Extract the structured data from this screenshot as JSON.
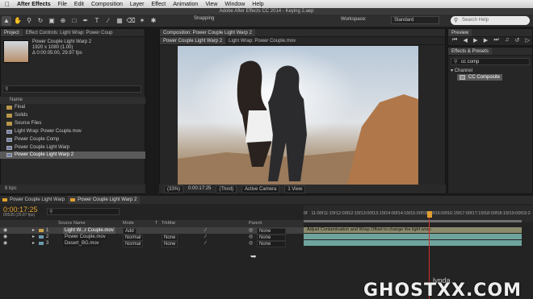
{
  "menubar": {
    "apple": "",
    "app": "After Effects",
    "items": [
      "File",
      "Edit",
      "Composition",
      "Layer",
      "Effect",
      "Animation",
      "View",
      "Window",
      "Help"
    ]
  },
  "titlebar": {
    "title": "Adobe After Effects CC 2014 - Keying 2.aep"
  },
  "toolbar": {
    "snapping_label": "Snapping",
    "workspace_label": "Workspace:",
    "workspace_value": "Standard",
    "search_placeholder": "Search Help"
  },
  "project": {
    "tabs": [
      "Project",
      "Effect Controls: Light Wrap: Power Coup"
    ],
    "selected_name": "Power Couple Light Warp 2",
    "selected_info": [
      "1920 x 1080 (1.00)",
      "Δ 0:00:05:00, 29.97 fps"
    ],
    "name_column": "Name",
    "items": [
      {
        "name": "Final",
        "type": "folder"
      },
      {
        "name": "Solids",
        "type": "folder"
      },
      {
        "name": "Source Files",
        "type": "folder"
      },
      {
        "name": "Light Wrap: Power Couple.mov",
        "type": "comp"
      },
      {
        "name": "Power Couple Comp",
        "type": "comp"
      },
      {
        "name": "Power Couple Light Warp",
        "type": "comp"
      },
      {
        "name": "Power Couple Light Warp 2",
        "type": "comp"
      }
    ],
    "footer": "8 bpc"
  },
  "composition": {
    "tab": "Composition: Power Couple Light Warp 2",
    "subtabs": [
      "Power Couple Light Warp 2",
      "Light Wrap: Power Couple.mov"
    ],
    "zoom": "(33%)",
    "timecode": "0:00:17:25",
    "resolution": "(Third)",
    "camera": "Active Camera",
    "views": "1 View"
  },
  "preview": {
    "tab": "Preview",
    "controls": [
      "first-frame-icon",
      "prev-frame-icon",
      "play-icon",
      "next-frame-icon",
      "last-frame-icon",
      "audio-icon",
      "loop-icon",
      "ram-preview-icon"
    ]
  },
  "effects": {
    "tab": "Effects & Presets",
    "search_value": "cc comp",
    "category": "Channel",
    "item": "CC Composite"
  },
  "timeline": {
    "tabs": [
      "Power Couple Light Warp",
      "Power Couple Light Warp 2"
    ],
    "timecode": "0:00:17:25",
    "frames": "00535 (29.97 fps)",
    "columns": {
      "source": "Source Name",
      "mode": "Mode",
      "t": "T",
      "trkmat": "TrkMat",
      "parent": "Parent"
    },
    "layers": [
      {
        "num": "1",
        "name": "Light W...r Couple.mov",
        "mode": "Add",
        "trkmat": "",
        "parent": "None",
        "color": "#c9a24a"
      },
      {
        "num": "2",
        "name": "Power Couple.mov",
        "mode": "Normal",
        "trkmat": "None",
        "parent": "None",
        "color": "#6a9ab0"
      },
      {
        "num": "3",
        "name": "Desert_BG.mov",
        "mode": "Normal",
        "trkmat": "None",
        "parent": "None",
        "color": "#6a9ab0"
      }
    ],
    "ruler_ticks": [
      "0f",
      "11:00f",
      "11:15f",
      "12:00f",
      "12:15f",
      "13:00f",
      "13:15f",
      "14:00f",
      "14:15f",
      "15:00f",
      "15:15f",
      "16:00f",
      "16:15f",
      "17:00f",
      "17:15f",
      "18:00f",
      "18:15f",
      "19:00f",
      "19:2"
    ],
    "layer1_comment": "Adjust Contamination and Wrap Offset to change the light wrap"
  },
  "watermark": {
    "text": "GHOSTXX.COM",
    "sub": "lynda"
  }
}
